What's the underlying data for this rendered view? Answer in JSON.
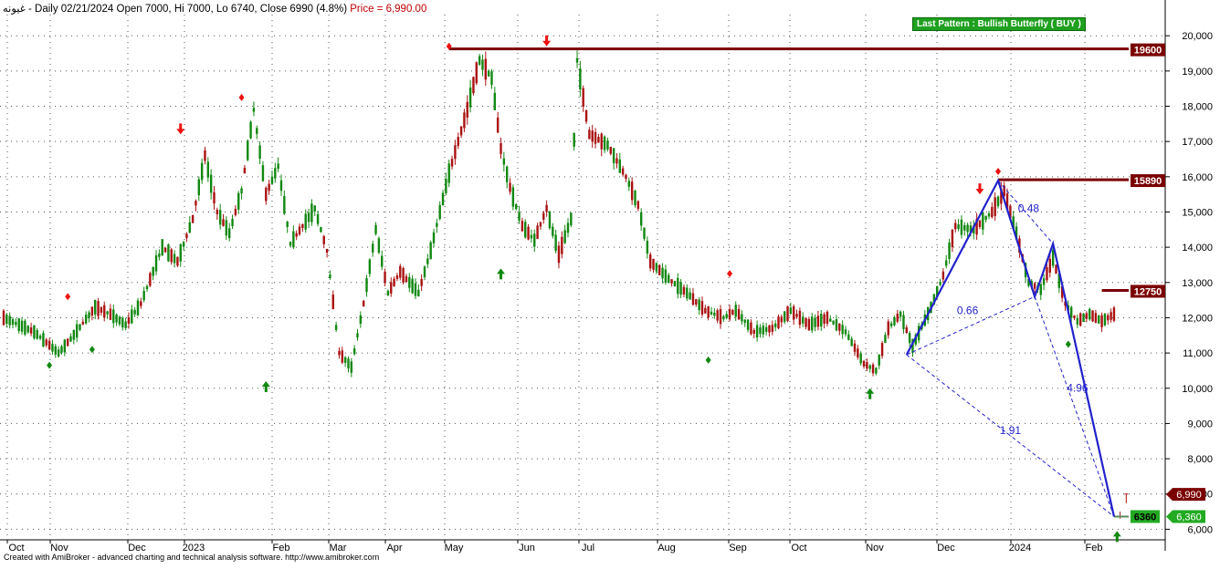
{
  "header": {
    "symbol": "غيونه",
    "info": " - Daily 02/21/2024 Open 7000, Hi 7000, Lo 6740, Close 6990 (4.8%)",
    "price_text": "Price = 6,990.00"
  },
  "pattern_label": "Last Pattern : Bullish Butterfly ( BUY )",
  "footer": "Created with AmiBroker - advanced charting and technical analysis software. http://www.amibroker.com",
  "colors": {
    "up": "#118811",
    "down": "#aa1111",
    "resistance": "#7a0000",
    "pattern": "#2222cc",
    "support_label": "#22aa22",
    "grid": "#555555"
  },
  "chart_data": {
    "type": "candlestick",
    "title": "غيونه - Daily",
    "ylim": [
      5700,
      20600
    ],
    "y_ticks": [
      6000,
      7000,
      8000,
      9000,
      10000,
      11000,
      12000,
      13000,
      14000,
      15000,
      16000,
      17000,
      18000,
      19000,
      20000
    ],
    "y_tick_labels": [
      "6,000",
      "7,000",
      "8,000",
      "9,000",
      "10,000",
      "11,000",
      "12,000",
      "13,000",
      "14,000",
      "15,000",
      "16,000",
      "17,000",
      "18,000",
      "19,000",
      "20,000"
    ],
    "x_labels": [
      "Oct",
      "Nov",
      "Dec",
      "2023",
      "Feb",
      "Mar",
      "Apr",
      "May",
      "Jun",
      "Jul",
      "Aug",
      "Sep",
      "Oct",
      "Nov",
      "Dec",
      "2024",
      "Feb"
    ],
    "grid": true,
    "last_bar": {
      "date": "02/21/2024",
      "open": 7000,
      "high": 7000,
      "low": 6740,
      "close": 6990
    },
    "price_path": [
      [
        0,
        12000
      ],
      [
        10,
        11600
      ],
      [
        18,
        11000
      ],
      [
        22,
        11400
      ],
      [
        30,
        12300
      ],
      [
        35,
        12100
      ],
      [
        40,
        11800
      ],
      [
        45,
        12400
      ],
      [
        52,
        14000
      ],
      [
        57,
        13600
      ],
      [
        62,
        14800
      ],
      [
        66,
        16600
      ],
      [
        70,
        15000
      ],
      [
        74,
        14400
      ],
      [
        78,
        15600
      ],
      [
        82,
        17900
      ],
      [
        86,
        15500
      ],
      [
        90,
        16300
      ],
      [
        94,
        14100
      ],
      [
        98,
        14600
      ],
      [
        102,
        15100
      ],
      [
        106,
        13900
      ],
      [
        110,
        11000
      ],
      [
        114,
        10600
      ],
      [
        118,
        12400
      ],
      [
        122,
        14500
      ],
      [
        126,
        12700
      ],
      [
        130,
        13300
      ],
      [
        136,
        12700
      ],
      [
        140,
        13900
      ],
      [
        146,
        16100
      ],
      [
        152,
        17900
      ],
      [
        156,
        19300
      ],
      [
        160,
        18800
      ],
      [
        163,
        16800
      ],
      [
        166,
        15700
      ],
      [
        170,
        14600
      ],
      [
        174,
        14200
      ],
      [
        178,
        15100
      ],
      [
        182,
        13800
      ],
      [
        186,
        14800
      ],
      [
        188,
        19300
      ],
      [
        192,
        17200
      ],
      [
        198,
        16900
      ],
      [
        204,
        16000
      ],
      [
        208,
        15200
      ],
      [
        212,
        13600
      ],
      [
        218,
        13100
      ],
      [
        224,
        12700
      ],
      [
        230,
        12200
      ],
      [
        236,
        12000
      ],
      [
        240,
        12200
      ],
      [
        246,
        11600
      ],
      [
        252,
        11700
      ],
      [
        258,
        12200
      ],
      [
        264,
        11800
      ],
      [
        270,
        12000
      ],
      [
        276,
        11600
      ],
      [
        282,
        10700
      ],
      [
        286,
        10500
      ],
      [
        290,
        11700
      ],
      [
        294,
        12100
      ],
      [
        298,
        11200
      ],
      [
        304,
        12300
      ],
      [
        308,
        13200
      ],
      [
        312,
        14600
      ],
      [
        318,
        14500
      ],
      [
        324,
        15000
      ],
      [
        328,
        15600
      ],
      [
        332,
        14400
      ],
      [
        336,
        13000
      ],
      [
        340,
        12800
      ],
      [
        344,
        13700
      ],
      [
        348,
        12400
      ],
      [
        352,
        11900
      ],
      [
        356,
        12100
      ],
      [
        360,
        11900
      ],
      [
        364,
        12100
      ],
      [
        366,
        12700
      ],
      [
        368,
        12700
      ]
    ],
    "signals": {
      "sell_diamonds": [
        [
          21,
          12600
        ],
        [
          78,
          18250
        ],
        [
          146,
          19700
        ],
        [
          238,
          13250
        ],
        [
          326,
          16150
        ]
      ],
      "sell_arrows": [
        [
          58,
          17200
        ],
        [
          178,
          19700
        ],
        [
          320,
          15500
        ]
      ],
      "buy_diamonds": [
        [
          15,
          10650
        ],
        [
          29,
          11100
        ],
        [
          231,
          10800
        ],
        [
          349,
          11250
        ]
      ],
      "buy_arrows": [
        [
          86,
          10200
        ],
        [
          163,
          13400
        ],
        [
          284,
          10000
        ],
        [
          365,
          5950
        ]
      ]
    },
    "resistance_lines": [
      {
        "value": 19600,
        "label": "19600",
        "start": 146
      },
      {
        "value": 15890,
        "label": "15890",
        "start": 326
      },
      {
        "value": 12750,
        "label": "12750",
        "start": 360
      }
    ],
    "support_lines": [
      {
        "value": 6360,
        "label": "6360",
        "start": 364
      }
    ],
    "price_tags": [
      {
        "value": 6990,
        "label": "6,990",
        "color": "#7a0000"
      },
      {
        "value": 6360,
        "label": "6,360",
        "color": "#22aa22"
      }
    ],
    "butterfly": {
      "points": [
        [
          296,
          10950
        ],
        [
          326,
          15890
        ],
        [
          338,
          12600
        ],
        [
          344,
          14100
        ],
        [
          364,
          6360
        ]
      ],
      "ratios": [
        {
          "value": "0.48",
          "at": [
            336,
            15000
          ]
        },
        {
          "value": "0.66",
          "at": [
            316,
            12100
          ]
        },
        {
          "value": "4.96",
          "at": [
            352,
            9900
          ]
        },
        {
          "value": "1.91",
          "at": [
            330,
            8700
          ]
        }
      ]
    }
  }
}
